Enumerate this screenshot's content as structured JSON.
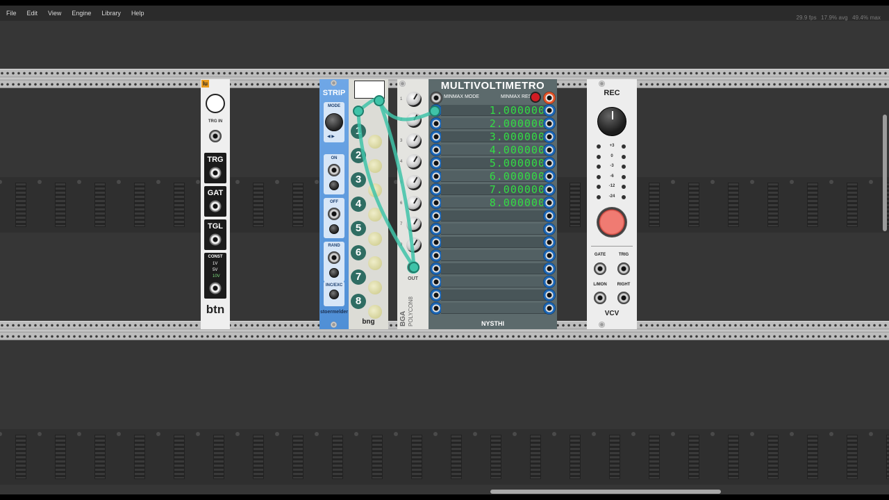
{
  "menu": [
    "File",
    "Edit",
    "View",
    "Engine",
    "Library",
    "Help"
  ],
  "stats": {
    "fps": "29.9 fps",
    "avg": "17.9% avg",
    "max": "49.4% max"
  },
  "btn_module": {
    "logo": "lu",
    "trg_in": "TRG IN",
    "buttons": [
      "TRG",
      "GAT",
      "TGL"
    ],
    "const": "CONST",
    "const_opts": [
      "1V",
      "5V",
      "10V"
    ],
    "name": "btn"
  },
  "strip": {
    "title": "STRIP",
    "sections": [
      "MODE",
      "ON",
      "OFF",
      "RAND",
      "INC/EXC"
    ],
    "brand": "stoermelder"
  },
  "flag": {
    "steps": [
      "1",
      "2",
      "3",
      "4",
      "5",
      "6",
      "7",
      "8"
    ],
    "brand": "bng"
  },
  "polycon": {
    "nums": [
      "1",
      "2",
      "3",
      "4",
      "5",
      "6",
      "7",
      "8"
    ],
    "out": "OUT",
    "name": "POLYCON8",
    "brand": "BGA"
  },
  "multivoltimetro": {
    "title": "MULTIVOLTIMETRO",
    "minmax_mode": "MINMAX MODE",
    "minmax_reset": "MINMAX RESET",
    "values": [
      "1.000000",
      "2.000000",
      "3.000000",
      "4.000000",
      "5.000000",
      "6.000000",
      "7.000000",
      "8.000000",
      "",
      "",
      "",
      "",
      "",
      "",
      "",
      ""
    ],
    "brand": "NYSTHI"
  },
  "rec": {
    "title": "REC",
    "levels": [
      "+3",
      "0",
      "-3",
      "-6",
      "-12",
      "-24"
    ],
    "gate": "GATE",
    "trig": "TRIG",
    "lmon": "L/MON",
    "right": "RIGHT",
    "brand": "VCV"
  },
  "colors": {
    "cable": "#3fc3a8",
    "display": "#33dd44",
    "rec": "#f07b72"
  }
}
